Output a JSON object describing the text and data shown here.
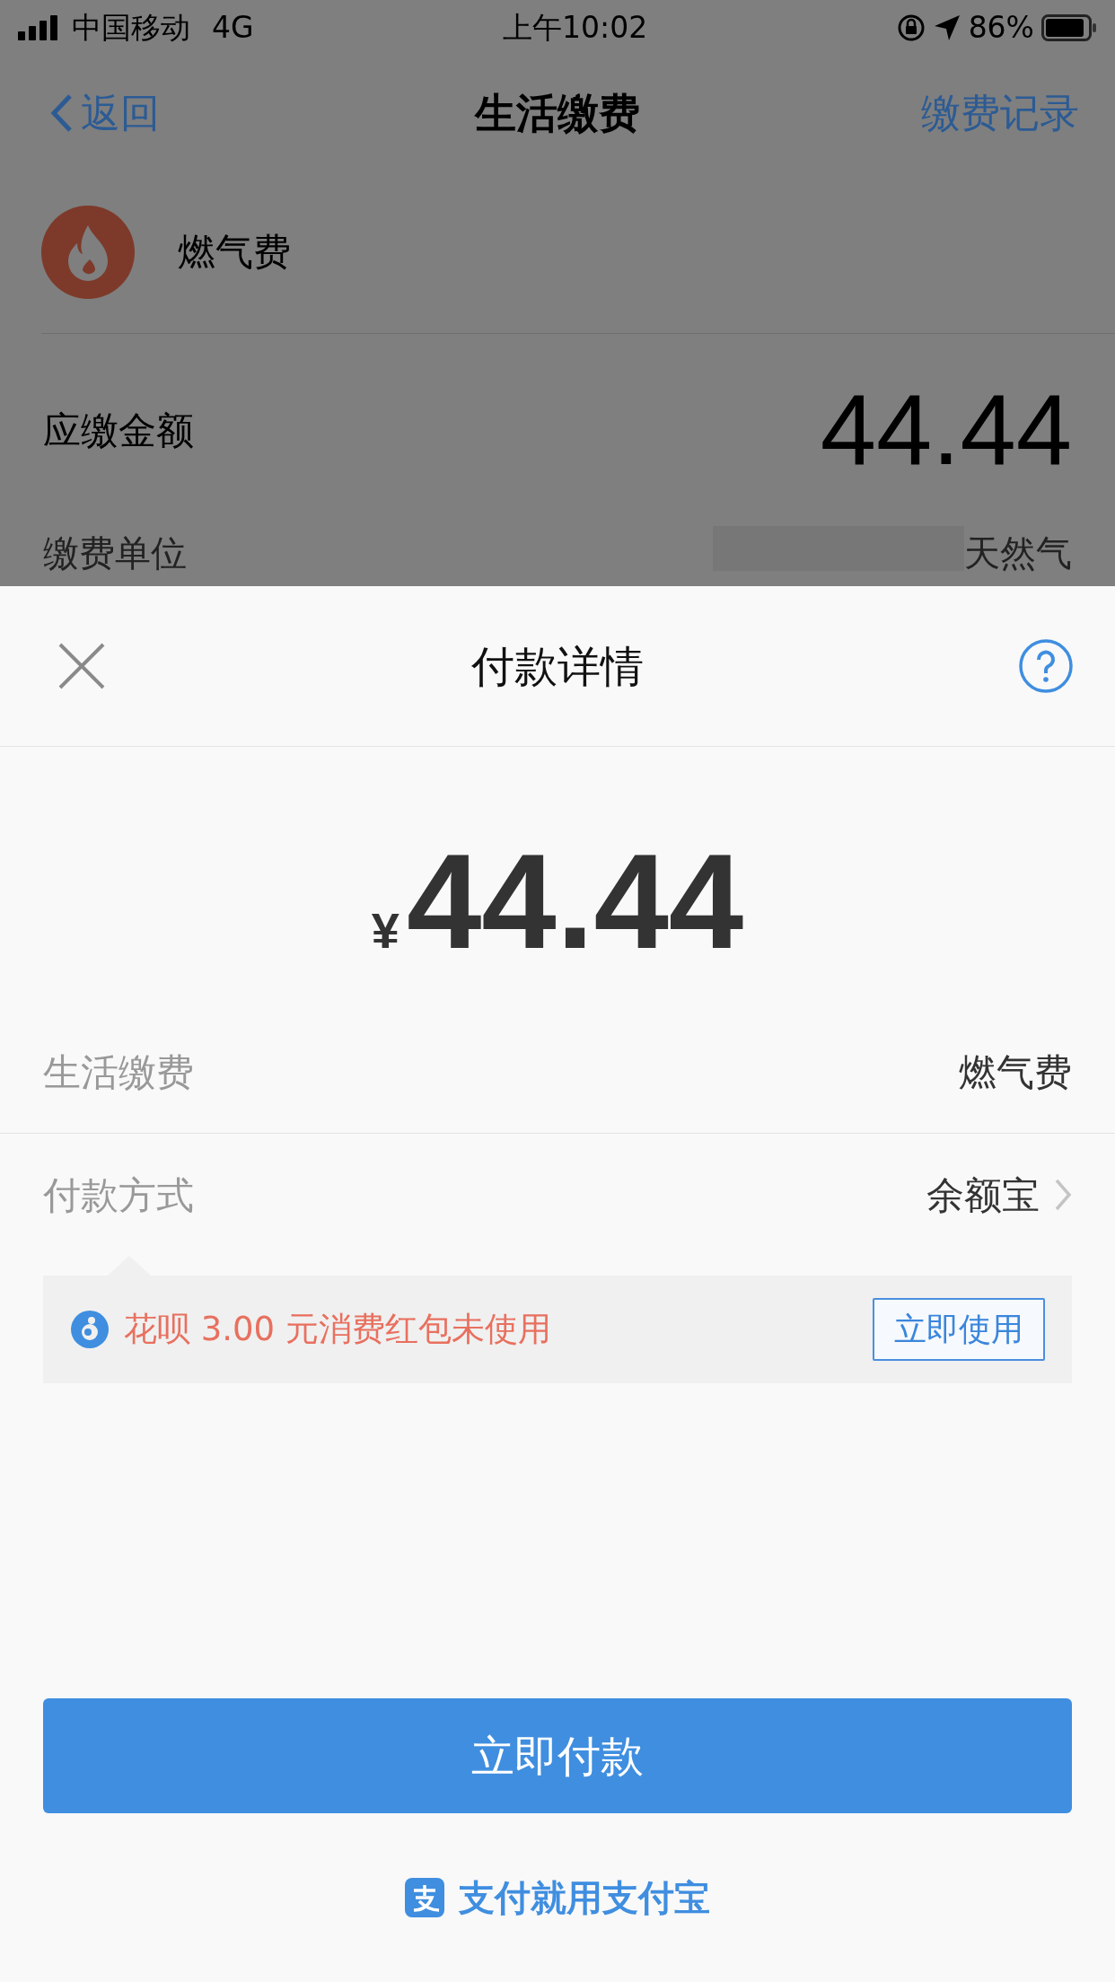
{
  "status_bar": {
    "carrier": "中国移动",
    "network": "4G",
    "time": "上午10:02",
    "battery": "86%"
  },
  "nav": {
    "back": "返回",
    "title": "生活缴费",
    "action": "缴费记录"
  },
  "bill": {
    "name": "燃气费",
    "amount_label": "应缴金额",
    "amount": "44.44",
    "fields": [
      {
        "label": "缴费单位",
        "value": "天然气"
      }
    ]
  },
  "sheet": {
    "title": "付款详情",
    "currency": "¥",
    "amount": "44.44",
    "rows": [
      {
        "label": "生活缴费",
        "value": "燃气费",
        "kind": "plain"
      },
      {
        "label": "付款方式",
        "value": "余额宝",
        "kind": "link"
      }
    ],
    "promo": {
      "text": "花呗 3.00 元消费红包未使用",
      "button": "立即使用"
    },
    "pay_button": "立即付款",
    "footer": "支付就用支付宝"
  }
}
